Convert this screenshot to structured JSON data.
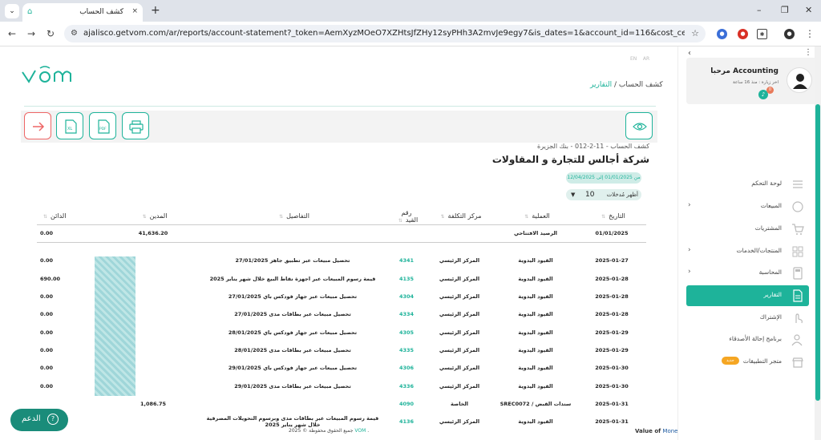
{
  "browser": {
    "tab_title": "كشف الحساب",
    "tab_close": "×",
    "new_tab": "+",
    "url": "ajalisco.getvom.com/ar/reports/account-statement?_token=AemXyzMOeO7XZHtsJfZHy12syPHh3A2mvJe9egy7&is_dates=1&account_id=116&cost_center_id=&fiscal_year_id=&fro..."
  },
  "page": {
    "lang_en": "EN",
    "lang_ar": "AR",
    "breadcrumb": {
      "reports": "التقارير",
      "sep": "/",
      "current": "كشف الحساب"
    },
    "report": {
      "account_line": "كشف الحساب - 11-2-012 - بنك الجزيرة",
      "company": "شركة أجالس للتجارة و المقاولات",
      "date_range": "من 01/01/2025 إلى 12/04/2025",
      "show_label": "أظهر مُدخلات",
      "show_value": "10"
    },
    "table": {
      "headers": {
        "date": "التاريخ",
        "operation": "العملية",
        "cost_center": "مركز التكلفة",
        "ref": "رقم القيد",
        "details": "التفاصيل",
        "debit": "المدين",
        "credit": "الدائن"
      },
      "opening": {
        "date": "01/01/2025",
        "label": "الرصيد الافتتاحي",
        "debit": "41,636.20",
        "credit": "0.00"
      },
      "rows": [
        {
          "date": "2025-01-27",
          "operation": "القيود اليدوية",
          "cost_center": "المركز الرئيسي",
          "ref": "4341",
          "details": "تحصيل مبيعات عبر تطبيق جاهز 27/01/2025",
          "debit": "",
          "credit": "0.00"
        },
        {
          "date": "2025-01-28",
          "operation": "القيود اليدوية",
          "cost_center": "المركز الرئيسي",
          "ref": "4135",
          "details": "قيمة رسوم المبيعات عبر اجهزة نقاط البيع خلال شهر يناير 2025",
          "debit": "",
          "credit": "690.00"
        },
        {
          "date": "2025-01-28",
          "operation": "القيود اليدوية",
          "cost_center": "المركز الرئيسي",
          "ref": "4304",
          "details": "تحصيل مبيعات عبر جهاز فودكس باي 27/01/2025",
          "debit": "",
          "credit": "0.00"
        },
        {
          "date": "2025-01-28",
          "operation": "القيود اليدوية",
          "cost_center": "المركز الرئيسي",
          "ref": "4334",
          "details": "تحصيل مبيعات عبر بطاقات مدى 27/01/2025",
          "debit": "",
          "credit": "0.00"
        },
        {
          "date": "2025-01-29",
          "operation": "القيود اليدوية",
          "cost_center": "المركز الرئيسي",
          "ref": "4305",
          "details": "تحصيل مبيعات عبر جهاز فودكس باي 28/01/2025",
          "debit": "",
          "credit": "0.00"
        },
        {
          "date": "2025-01-29",
          "operation": "القيود اليدوية",
          "cost_center": "المركز الرئيسي",
          "ref": "4335",
          "details": "تحصيل مبيعات عبر بطاقات مدى 28/01/2025",
          "debit": "",
          "credit": "0.00"
        },
        {
          "date": "2025-01-30",
          "operation": "القيود اليدوية",
          "cost_center": "المركز الرئيسي",
          "ref": "4306",
          "details": "تحصيل مبيعات عبر جهاز فودكس باي 29/01/2025",
          "debit": "",
          "credit": "0.00"
        },
        {
          "date": "2025-01-30",
          "operation": "القيود اليدوية",
          "cost_center": "المركز الرئيسي",
          "ref": "4336",
          "details": "تحصيل مبيعات عبر بطاقات مدى 29/01/2025",
          "debit": "",
          "credit": "0.00"
        },
        {
          "date": "2025-01-31",
          "operation": "سندات القبض / SREC0072",
          "cost_center": "الخاصة",
          "ref": "4090",
          "details": "",
          "debit": "1,086.75",
          "credit": ""
        },
        {
          "date": "2025-01-31",
          "operation": "القيود اليدوية",
          "cost_center": "المركز الرئيسي",
          "ref": "4136",
          "details": "قيمة رسوم المبيعات عبر بطاقات مدى وبرسوم التحويلات المصرفية خلال شهر يناير 2025",
          "debit": "",
          "credit": "0.00"
        }
      ]
    },
    "footer": {
      "prefix": "جميع الحقوق محفوظة © 2025",
      "brand": "VOM",
      "suffix": "."
    },
    "value_of": "Value of",
    "money": "Money",
    "help": "الدعم",
    "help_icon": "?"
  },
  "sidebar": {
    "greeting": "مرحبا Accounting",
    "last_visit": "اخر زيارة : منذ 16 ساعة",
    "notif_count": "0",
    "items": [
      {
        "label": "لوحة التحكم",
        "chevron": false,
        "active": false,
        "icon": "list-icon"
      },
      {
        "label": "المبيعات",
        "chevron": true,
        "active": false,
        "icon": "coins-icon"
      },
      {
        "label": "المشتريات",
        "chevron": false,
        "active": false,
        "icon": "cart-icon"
      },
      {
        "label": "المنتجات/الخدمات",
        "chevron": true,
        "active": false,
        "icon": "boxes-icon"
      },
      {
        "label": "المحاسبة",
        "chevron": true,
        "active": false,
        "icon": "calculator-icon"
      },
      {
        "label": "التقارير",
        "chevron": false,
        "active": true,
        "icon": "report-icon"
      },
      {
        "label": "الإشتراك",
        "chevron": false,
        "active": false,
        "icon": "hand-icon"
      },
      {
        "label": "برنامج إحالة الأصدقاء",
        "chevron": false,
        "active": false,
        "icon": "users-icon"
      },
      {
        "label": "متجر التطبيقات",
        "chevron": false,
        "active": false,
        "icon": "store-icon",
        "badge": "جديد"
      }
    ]
  },
  "colors": {
    "accent": "#1eb39a",
    "danger": "#e66666",
    "help_bg": "#1a8c7a"
  }
}
